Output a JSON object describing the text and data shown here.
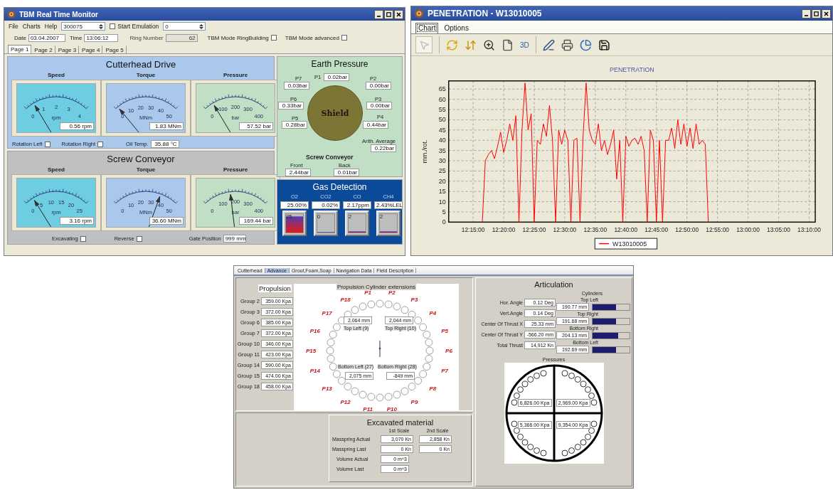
{
  "monitor": {
    "title": "TBM Real Time Monitor",
    "menu": [
      "File",
      "Charts",
      "Help"
    ],
    "counter": "300075",
    "emulation": {
      "label": "Start Emulation",
      "checked": false,
      "value": "0"
    },
    "date": {
      "label": "Date",
      "value": "03.04.2007"
    },
    "time": {
      "label": "Time",
      "value": "13:06:12"
    },
    "ring": {
      "label": "Ring Number",
      "value": "62"
    },
    "modes": [
      {
        "label": "TBM Mode RingBuilding",
        "checked": false
      },
      {
        "label": "TBM Mode advanced",
        "checked": false
      }
    ],
    "tabs": [
      {
        "label": "Page 1",
        "selected": true
      },
      {
        "label": "Page 2",
        "selected": false
      },
      {
        "label": "Page 3",
        "selected": false
      },
      {
        "label": "Page 4",
        "selected": false
      },
      {
        "label": "Page 5",
        "selected": false
      }
    ],
    "cutterhead": {
      "title": "Cutterhead Drive",
      "gauges": [
        {
          "label": "Speed",
          "unit": "rpm",
          "ticks": [
            "0",
            "1",
            "2",
            "3",
            "4"
          ],
          "reading": "0.56 rpm",
          "level": 0.14,
          "color": "#6ecde0"
        },
        {
          "label": "Torque",
          "unit": "MNm",
          "ticks": [
            "0",
            "10",
            "20",
            "30",
            "40",
            "50"
          ],
          "reading": "1.83 MNm",
          "level": 0.04,
          "color": "#a9c8ec"
        },
        {
          "label": "Pressure",
          "unit": "bar",
          "ticks": [
            "0",
            "100",
            "200",
            "300",
            "400"
          ],
          "reading": "57.52 bar",
          "level": 0.14,
          "color": "#c1dfc5"
        }
      ],
      "checks": [
        {
          "label": "Rotation Left",
          "checked": false
        },
        {
          "label": "Rotation Right",
          "checked": false
        }
      ],
      "oil": {
        "label": "Oil Temp.",
        "value": "35.88 °C"
      }
    },
    "earth": {
      "title": "Earth Pressure",
      "sensors": [
        {
          "label": "P7",
          "value": "0.03bar"
        },
        {
          "label": "P1",
          "value": "0.02bar"
        },
        {
          "label": "P2",
          "value": "0.00bar"
        },
        {
          "label": "P6",
          "value": "0.33bar"
        },
        {
          "label": "P3",
          "value": "0.00bar"
        },
        {
          "label": "P5",
          "value": "0.28bar"
        },
        {
          "label": "P4",
          "value": "0.44bar"
        }
      ],
      "shield": "Shield",
      "average": {
        "label": "Arith. Average",
        "value": "0.22bar"
      },
      "screw_title": "Screw Conveyor",
      "screw": [
        {
          "label": "Front",
          "value": "2.44bar"
        },
        {
          "label": "Back",
          "value": "0.01bar"
        }
      ]
    },
    "gas": {
      "title": "Gas Detection",
      "sensors": [
        {
          "label": "O2",
          "value": "25.00%",
          "bar": "25",
          "level": 0.85
        },
        {
          "label": "CO2",
          "value": "0.02%",
          "bar": "0",
          "level": 0
        },
        {
          "label": "CO",
          "value": "2.17ppm",
          "bar": "2",
          "level": 0.02
        },
        {
          "label": "CH4",
          "value": "2.43%LEL",
          "bar": "2",
          "level": 0.02
        }
      ]
    },
    "screw": {
      "title": "Screw Conveyor",
      "gauges": [
        {
          "label": "Speed",
          "unit": "rpm",
          "ticks": [
            "0",
            "5",
            "10",
            "15",
            "20",
            "25"
          ],
          "reading": "3.16 rpm",
          "level": 0.13,
          "color": "#6ecde0"
        },
        {
          "label": "Torque",
          "unit": "MNm",
          "ticks": [
            "0",
            "10",
            "20",
            "30",
            "40",
            "50"
          ],
          "reading": "36.60 MNm",
          "level": 0.73,
          "color": "#a9c8ec"
        },
        {
          "label": "Pressure",
          "unit": "bar",
          "ticks": [
            "0",
            "100",
            "200",
            "300",
            "400"
          ],
          "reading": "169.44 bar",
          "level": 0.42,
          "color": "#c1dfc5"
        }
      ],
      "checks": [
        {
          "label": "Excavating",
          "checked": false
        },
        {
          "label": "Reverse",
          "checked": false
        }
      ],
      "gate": {
        "label": "Gate Position",
        "value": "999 mm"
      }
    }
  },
  "penetration": {
    "title": "PENETRATION - W13010005",
    "tabs": [
      {
        "label": "Chart",
        "selected": true
      },
      {
        "label": "Options",
        "selected": false
      }
    ],
    "view_3d": "3D",
    "chart_data": {
      "type": "line",
      "grid": true,
      "title": "PENETRATION",
      "ylabel": "mm./rot.",
      "ylim": [
        0,
        69
      ],
      "yticks": [
        0,
        5,
        10,
        15,
        20,
        25,
        30,
        35,
        40,
        45,
        50,
        55,
        60,
        65
      ],
      "categories": [
        null,
        null,
        null,
        null,
        null,
        null,
        null,
        null,
        "12:15:00",
        null,
        null,
        null,
        null,
        null,
        null,
        null,
        null,
        null,
        "12:20:00",
        null,
        null,
        null,
        null,
        null,
        null,
        null,
        null,
        null,
        "12:25:00",
        null,
        null,
        null,
        null,
        null,
        null,
        null,
        null,
        null,
        "12:30:00",
        null,
        null,
        null,
        null,
        null,
        null,
        null,
        null,
        null,
        "12:35:00",
        null,
        null,
        null,
        null,
        null,
        null,
        null,
        null,
        null,
        "12:40:00",
        null,
        null,
        null,
        null,
        null,
        null,
        null,
        null,
        null,
        "12:45:00",
        null,
        null,
        null,
        null,
        null,
        null,
        null,
        null,
        null,
        "12:50:00",
        null,
        null,
        null,
        null,
        null,
        null,
        null,
        null,
        null,
        "12:55:00",
        null,
        null,
        null,
        null,
        null,
        null,
        null,
        null,
        null,
        "13:00:00",
        null,
        null,
        null,
        null,
        null,
        null,
        null,
        null,
        null,
        "13:05:00",
        null,
        null,
        null,
        null,
        null,
        null,
        null,
        null,
        null,
        "13:10:00",
        null,
        null
      ],
      "series": [
        {
          "name": "W13010005",
          "color": "#ff0000",
          "values": [
            null,
            null,
            null,
            null,
            null,
            null,
            null,
            null,
            null,
            null,
            null,
            0,
            30,
            33,
            35,
            31,
            37,
            44,
            34,
            40,
            48,
            40,
            52,
            0,
            45,
            68,
            45,
            53,
            0,
            40,
            38,
            48,
            42,
            57,
            40,
            0,
            45,
            38,
            45,
            40,
            0,
            40,
            41,
            0,
            42,
            68,
            45,
            40,
            38,
            48,
            35,
            40,
            33,
            38,
            45,
            21,
            40,
            0,
            42,
            37,
            40,
            41,
            38,
            42,
            35,
            0,
            45,
            40,
            0,
            40,
            0,
            40,
            40,
            46,
            36,
            50,
            38,
            48,
            37,
            46,
            36,
            48,
            38,
            40,
            38,
            0,
            null,
            null,
            null,
            null,
            null,
            null,
            null,
            null,
            null,
            null,
            null,
            null,
            null,
            null,
            null,
            null,
            null,
            null,
            null,
            null,
            null,
            null,
            null,
            null,
            null,
            null,
            null,
            null,
            null,
            null,
            null,
            null,
            null,
            null,
            null
          ]
        }
      ]
    }
  },
  "advance": {
    "tabs": [
      {
        "label": "Cutterhead",
        "selected": false
      },
      {
        "label": "Advance",
        "selected": true
      },
      {
        "label": "Grout,Foam,Soap",
        "selected": false
      },
      {
        "label": "Navigation Data",
        "selected": false
      },
      {
        "label": "Field Description",
        "selected": false
      }
    ],
    "propulsion": {
      "title": "Propulsion",
      "groups": [
        {
          "label": "Group 2",
          "value": "359.00 Kpa"
        },
        {
          "label": "Group 3",
          "value": "372.00 Kpa"
        },
        {
          "label": "Group 6",
          "value": "385.00 Kpa"
        },
        {
          "label": "Group 7",
          "value": "372.00 Kpa"
        },
        {
          "label": "Group 10",
          "value": "346.00 Kpa"
        },
        {
          "label": "Group 11",
          "value": "423.00 Kpa"
        },
        {
          "label": "Group 14",
          "value": "590.00 Kpa"
        },
        {
          "label": "Group 15",
          "value": "474.00 Kpa"
        },
        {
          "label": "Group 18",
          "value": "458.00 Kpa"
        }
      ]
    },
    "cylinders": {
      "title": "Propulsion Cylinder extensions",
      "markers": [
        "P1",
        "P2",
        "P3",
        "P4",
        "P5",
        "P6",
        "P7",
        "P8",
        "P9",
        "P10",
        "P11",
        "P12",
        "P13",
        "P14",
        "P15",
        "P16",
        "P17",
        "P18"
      ],
      "readouts": [
        {
          "label": "Top Left (9)",
          "value": "2,064 mm"
        },
        {
          "label": "Top Right (10)",
          "value": "2,044 mm"
        },
        {
          "label": "Bottom Left (27)",
          "value": "2,075 mm"
        },
        {
          "label": "Bottom Right (28)",
          "value": "-849 mm"
        }
      ]
    },
    "excavated": {
      "title": "Excavated material",
      "columns": [
        "1st Scale",
        "2nd Scale"
      ],
      "rows": [
        {
          "label": "Masspring Actual",
          "values": [
            "3,070 Kn",
            "2,858 Kn"
          ]
        },
        {
          "label": "Masspring Last",
          "values": [
            "0 Kn",
            "0 Kn"
          ]
        }
      ],
      "volumes": [
        {
          "label": "Volume Actual",
          "value": "0 m^3"
        },
        {
          "label": "Volume Last",
          "value": "0 m^3"
        }
      ]
    },
    "articulation": {
      "title": "Articulation",
      "fields": [
        {
          "label": "Hor. Angle",
          "value": "0.12 Deg"
        },
        {
          "label": "Vert.Angle",
          "value": "0.14 Deg"
        },
        {
          "label": "Center Of Thrust X",
          "value": "25.33 mm"
        },
        {
          "label": "Center Of Thrust Y",
          "value": "-566.20 mm"
        },
        {
          "label": "Total Thrust",
          "value": "14,912 Kn"
        }
      ],
      "cylinders_title": "Cylinders",
      "cylinders": [
        {
          "label": "Top Left",
          "value": "190.77 mm",
          "level": 0.63
        },
        {
          "label": "Top Right",
          "value": "191.68 mm",
          "level": 0.63
        },
        {
          "label": "Bottom Right",
          "value": "204.13 mm",
          "level": 0.69
        },
        {
          "label": "Bottom Left",
          "value": "192.69 mm",
          "level": 0.63
        }
      ],
      "pressures_title": "Pressures",
      "pressures": [
        "6,826.00 Kpa",
        "2,969.00 Kpa",
        "5,366.00 Kpa",
        "9,354.00 Kpa"
      ]
    }
  }
}
